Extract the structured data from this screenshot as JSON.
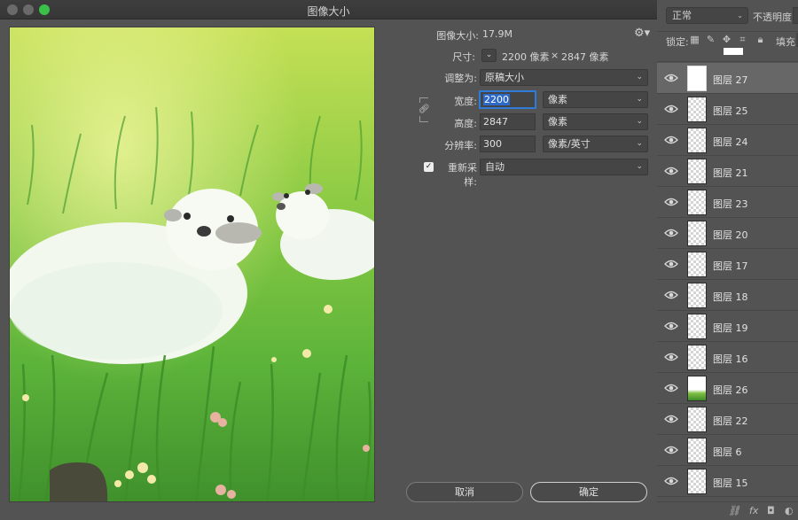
{
  "dialog": {
    "title": "图像大小",
    "image_size_label": "图像大小:",
    "image_size_value": "17.9M",
    "dimensions_label": "尺寸:",
    "dimensions_width": "2200 像素",
    "dimensions_times": "×",
    "dimensions_height": "2847 像素",
    "fit_to_label": "调整为:",
    "fit_to_value": "原稿大小",
    "width_label": "宽度:",
    "width_value": "2200",
    "width_unit": "像素",
    "height_label": "高度:",
    "height_value": "2847",
    "height_unit": "像素",
    "resolution_label": "分辨率:",
    "resolution_value": "300",
    "resolution_unit": "像素/英寸",
    "resample_label": "重新采样:",
    "resample_checked": true,
    "resample_value": "自动",
    "cancel_label": "取消",
    "ok_label": "确定"
  },
  "layers_panel": {
    "blend_mode": "正常",
    "opacity_label": "不透明度:",
    "lock_label": "锁定:",
    "fill_label": "填充:",
    "layers": [
      {
        "name": "图层 27",
        "selected": true,
        "thumb": "white"
      },
      {
        "name": "图层 25",
        "thumb": "checker"
      },
      {
        "name": "图层 24",
        "thumb": "checker"
      },
      {
        "name": "图层 21",
        "thumb": "checker"
      },
      {
        "name": "图层 23",
        "thumb": "checker"
      },
      {
        "name": "图层 20",
        "thumb": "checker"
      },
      {
        "name": "图层 17",
        "thumb": "checker"
      },
      {
        "name": "图层 18",
        "thumb": "checker"
      },
      {
        "name": "图层 19",
        "thumb": "checker"
      },
      {
        "name": "图层 16",
        "thumb": "checker"
      },
      {
        "name": "图层 26",
        "thumb": "grass"
      },
      {
        "name": "图层 22",
        "thumb": "checker"
      },
      {
        "name": "图层 6",
        "thumb": "checker"
      },
      {
        "name": "图层 15",
        "thumb": "checker"
      }
    ],
    "bottom_fx_label": "fx"
  },
  "colors": {
    "panel_bg": "#535353",
    "accent_blue": "#2f7bd8",
    "max_button_green": "#3ac14a"
  }
}
